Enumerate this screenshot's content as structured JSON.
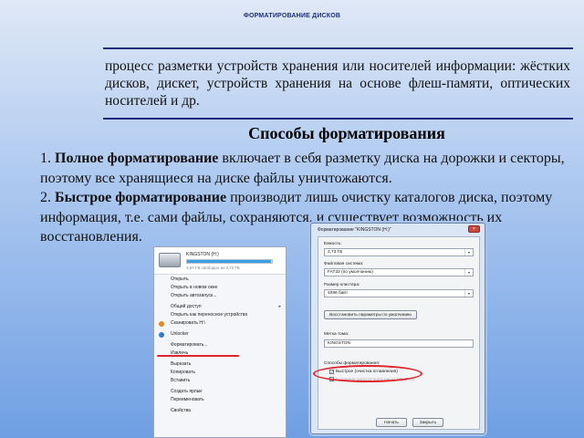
{
  "slide": {
    "title": "ФОРМАТИРОВАНИЕ ДИСКОВ",
    "definition": "процесс разметки устройств хранения или носителей информации: жёстких дисков, дискет, устройств хранения на основе флеш-памяти, оптических носителей и др.",
    "section_heading": "Способы форматирования",
    "methods": [
      {
        "number": "1.",
        "term": "Полное форматирование",
        "text": " включает в себя разметку диска на дорожки и секторы, поэтому все хранящиеся на диске файлы уничтожаются."
      },
      {
        "number": "2.",
        "term": "Быстрое форматирование",
        "text": " производит лишь очистку каталогов диска, поэтому информация, т.е. сами файлы, сохраняются, и существует возможность их восстановления."
      }
    ]
  },
  "context_menu": {
    "drive_label": "KINGSTON (H:)",
    "drive_free": "3,67 ГБ свободно из 3,72 ГБ",
    "drive_used_fraction": 0.99,
    "items": [
      {
        "label": "Открыть",
        "icon": "",
        "separator_before": false,
        "submenu": false
      },
      {
        "label": "Открыть в новом окне",
        "icon": "",
        "separator_before": false,
        "submenu": false
      },
      {
        "label": "Открыть автозапуск...",
        "icon": "",
        "separator_before": false,
        "submenu": false
      },
      {
        "label": "Общий доступ",
        "icon": "",
        "separator_before": true,
        "submenu": true
      },
      {
        "label": "Открыть как переносное устройство",
        "icon": "",
        "separator_before": false,
        "submenu": false
      },
      {
        "label": "Сканировать H:\\",
        "icon": "antivirus-icon",
        "separator_before": false,
        "submenu": false
      },
      {
        "label": "Unlocker",
        "icon": "unlocker-icon",
        "separator_before": true,
        "submenu": false
      },
      {
        "label": "Форматировать...",
        "icon": "",
        "separator_before": true,
        "submenu": false
      },
      {
        "label": "Извлечь",
        "icon": "",
        "separator_before": false,
        "submenu": false
      },
      {
        "label": "Вырезать",
        "icon": "",
        "separator_before": true,
        "submenu": false
      },
      {
        "label": "Копировать",
        "icon": "",
        "separator_before": false,
        "submenu": false
      },
      {
        "label": "Вставить",
        "icon": "",
        "separator_before": false,
        "submenu": false
      },
      {
        "label": "Создать ярлык",
        "icon": "",
        "separator_before": true,
        "submenu": false
      },
      {
        "label": "Переименовать",
        "icon": "",
        "separator_before": false,
        "submenu": false
      },
      {
        "label": "Свойства",
        "icon": "",
        "separator_before": true,
        "submenu": false
      }
    ],
    "colors": {
      "antivirus": "#e8861a",
      "unlocker": "#2e7bd6",
      "highlight_underline": "#e0242b"
    }
  },
  "format_dialog": {
    "title": "Форматирование \"KINGSTON (H:)\"",
    "close_glyph": "×",
    "capacity_label": "Емкость:",
    "capacity_value": "3,73 ГБ",
    "filesystem_label": "Файловая система:",
    "filesystem_value": "FAT32 (по умолчанию)",
    "cluster_label": "Размер кластера:",
    "cluster_value": "4096 байт",
    "restore_button": "Восстановить параметры по умолчанию",
    "volume_label_label": "Метка тома:",
    "volume_label_value": "KINGSTON",
    "options_label": "Способы форматирования:",
    "quick_format_label": "Быстрое (очистка оглавления)",
    "quick_format_checked": true,
    "msdos_label": "Создание загрузочного диска MS-DOS",
    "msdos_checked": false,
    "start_button": "Начать",
    "close_button": "Закрыть",
    "check_glyph": "✓",
    "dropdown_glyph": "▾"
  }
}
